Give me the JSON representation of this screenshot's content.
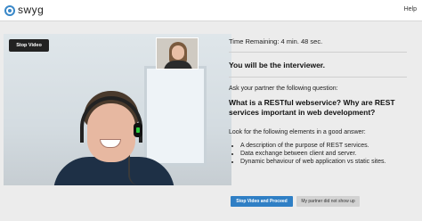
{
  "header": {
    "brand": "swyg",
    "help_label": "Help"
  },
  "video": {
    "stop_button_label": "Stop Video"
  },
  "panel": {
    "time_remaining": "Time Remaining: 4 min. 48 sec.",
    "role": "You will be the interviewer.",
    "ask_prompt": "Ask your partner the following question:",
    "question": "What is a RESTful webservice? Why are REST services important in web development?",
    "look_for": "Look for the following elements in a good answer:",
    "answers": [
      "A description of the purpose of REST services.",
      "Data exchange between client and server.",
      "Dynamic behaviour of web application vs static sites."
    ]
  },
  "actions": {
    "proceed_label": "Stop Video and Proceed",
    "no_show_label": "My partner did not show up"
  },
  "colors": {
    "primary_button": "#2f7fc5",
    "secondary_button": "#d2d2d2",
    "logo": "#3a88c8"
  }
}
